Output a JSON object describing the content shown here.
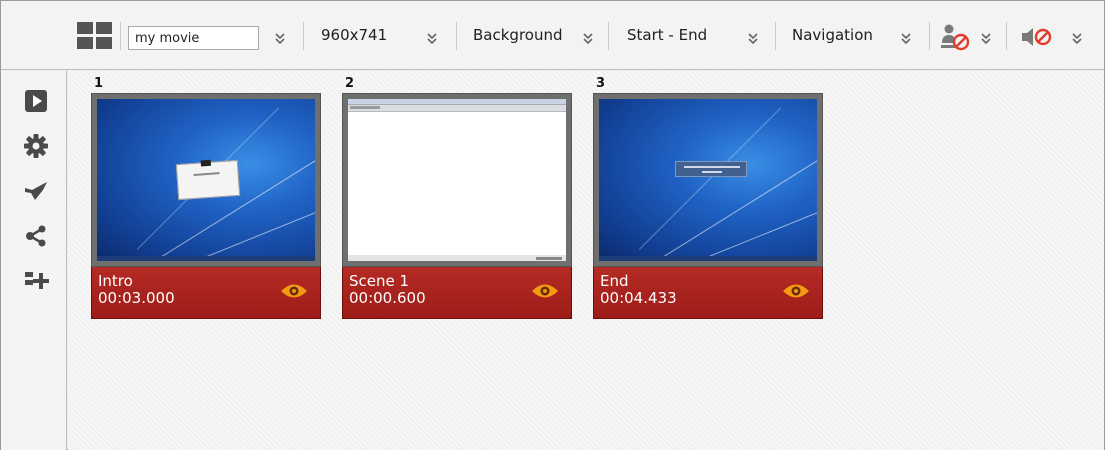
{
  "toolbar": {
    "layout_icon": "grid-layout-icon",
    "title_value": "my movie",
    "size_label": "960x741",
    "background_label": "Background",
    "range_label": "Start - End",
    "navigation_label": "Navigation",
    "presenter_icon": "no-presenter-icon",
    "audio_icon": "mute-icon",
    "dropdown_icon": "double-chevron-down-icon"
  },
  "sidebar": {
    "items": [
      {
        "icon": "play-icon"
      },
      {
        "icon": "gear-icon"
      },
      {
        "icon": "check-icon"
      },
      {
        "icon": "share-icon"
      },
      {
        "icon": "add-scene-icon"
      }
    ]
  },
  "scenes": [
    {
      "number": "1",
      "name": "Intro",
      "time": "00:03.000",
      "preview": "desktop-with-dialog"
    },
    {
      "number": "2",
      "name": "Scene 1",
      "time": "00:00.600",
      "preview": "application-window"
    },
    {
      "number": "3",
      "name": "End",
      "time": "00:04.433",
      "preview": "desktop-with-message"
    }
  ],
  "colors": {
    "caption_red": "#a3211c",
    "eye_orange": "#f39a12",
    "toolbar_bg": "#f3f3f3"
  }
}
